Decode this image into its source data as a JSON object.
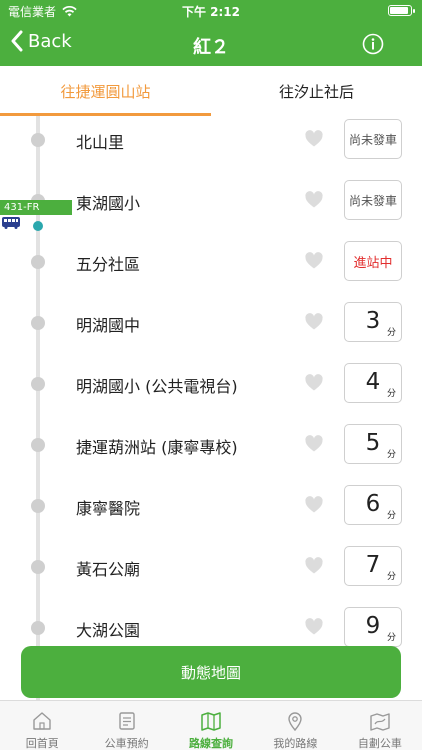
{
  "status_bar": {
    "carrier": "電信業者",
    "time": "下午 2:12",
    "battery_level": 0.95
  },
  "nav": {
    "back_label": "Back",
    "title": "紅２"
  },
  "tabs": [
    {
      "label": "往捷運圓山站",
      "active": true
    },
    {
      "label": "往汐止社后",
      "active": false
    }
  ],
  "bus": {
    "plate": "431-FR"
  },
  "stops": [
    {
      "name": "北山里",
      "eta_text": "尚未發車",
      "eta_minutes": null
    },
    {
      "name": "東湖國小",
      "eta_text": "尚未發車",
      "eta_minutes": null
    },
    {
      "name": "五分社區",
      "eta_text": "進站中",
      "eta_minutes": null
    },
    {
      "name": "明湖國中",
      "eta_text": "",
      "eta_minutes": "3"
    },
    {
      "name": "明湖國小 (公共電視台)",
      "eta_text": "",
      "eta_minutes": "4"
    },
    {
      "name": "捷運葫洲站 (康寧專校)",
      "eta_text": "",
      "eta_minutes": "5"
    },
    {
      "name": "康寧醫院",
      "eta_text": "",
      "eta_minutes": "6"
    },
    {
      "name": "黃石公廟",
      "eta_text": "",
      "eta_minutes": "7"
    },
    {
      "name": "大湖公園",
      "eta_text": "",
      "eta_minutes": "9"
    }
  ],
  "minute_unit": "分",
  "map_button_label": "動態地圖",
  "tabbar": [
    {
      "label": "回首頁",
      "icon": "home-icon",
      "active": false
    },
    {
      "label": "公車預約",
      "icon": "booking-icon",
      "active": false
    },
    {
      "label": "路線查詢",
      "icon": "route-map-icon",
      "active": true
    },
    {
      "label": "我的路線",
      "icon": "location-pin-icon",
      "active": false
    },
    {
      "label": "自劃公車",
      "icon": "custom-route-icon",
      "active": false
    }
  ],
  "colors": {
    "primary": "#4caf3e",
    "active_tab": "#f29a3d",
    "arriving": "#e22e2e",
    "bus_dot": "#2aa7ad"
  }
}
